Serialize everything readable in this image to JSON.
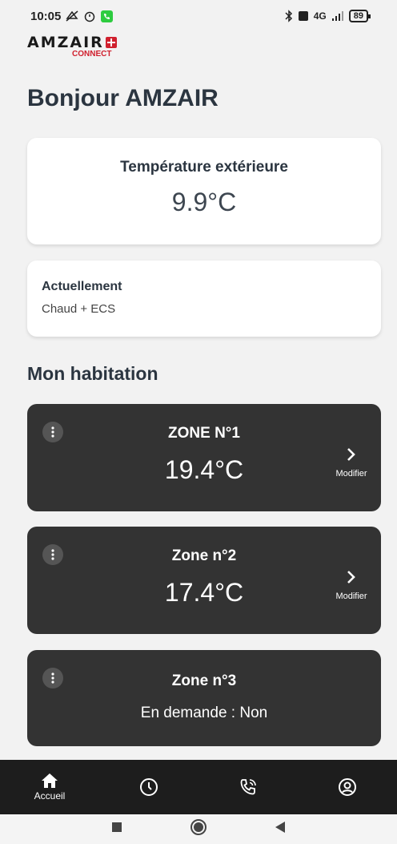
{
  "status_bar": {
    "time": "10:05",
    "battery": "89",
    "network": "4G"
  },
  "app": {
    "logo_main": "AMZAIR",
    "logo_sub": "CONNECT",
    "brand_color": "#d0202e"
  },
  "greeting": "Bonjour AMZAIR",
  "outdoor": {
    "label": "Température extérieure",
    "value": "9.9°C"
  },
  "mode": {
    "label": "Actuellement",
    "value": "Chaud + ECS"
  },
  "section_title": "Mon habitation",
  "zones": [
    {
      "name": "ZONE N°1",
      "temperature": "19.4°C",
      "modify_label": "Modifier"
    },
    {
      "name": "Zone n°2",
      "temperature": "17.4°C",
      "modify_label": "Modifier"
    },
    {
      "name": "Zone n°3",
      "demand": "En demande : Non"
    }
  ],
  "bottom_nav": {
    "items": [
      {
        "icon": "home-icon",
        "label": "Accueil"
      },
      {
        "icon": "clock-icon"
      },
      {
        "icon": "phone-icon"
      },
      {
        "icon": "user-icon"
      }
    ]
  },
  "colors": {
    "zone_bg": "#333333",
    "page_bg": "#f2f2f2",
    "nav_bg": "#1d1d1d"
  }
}
